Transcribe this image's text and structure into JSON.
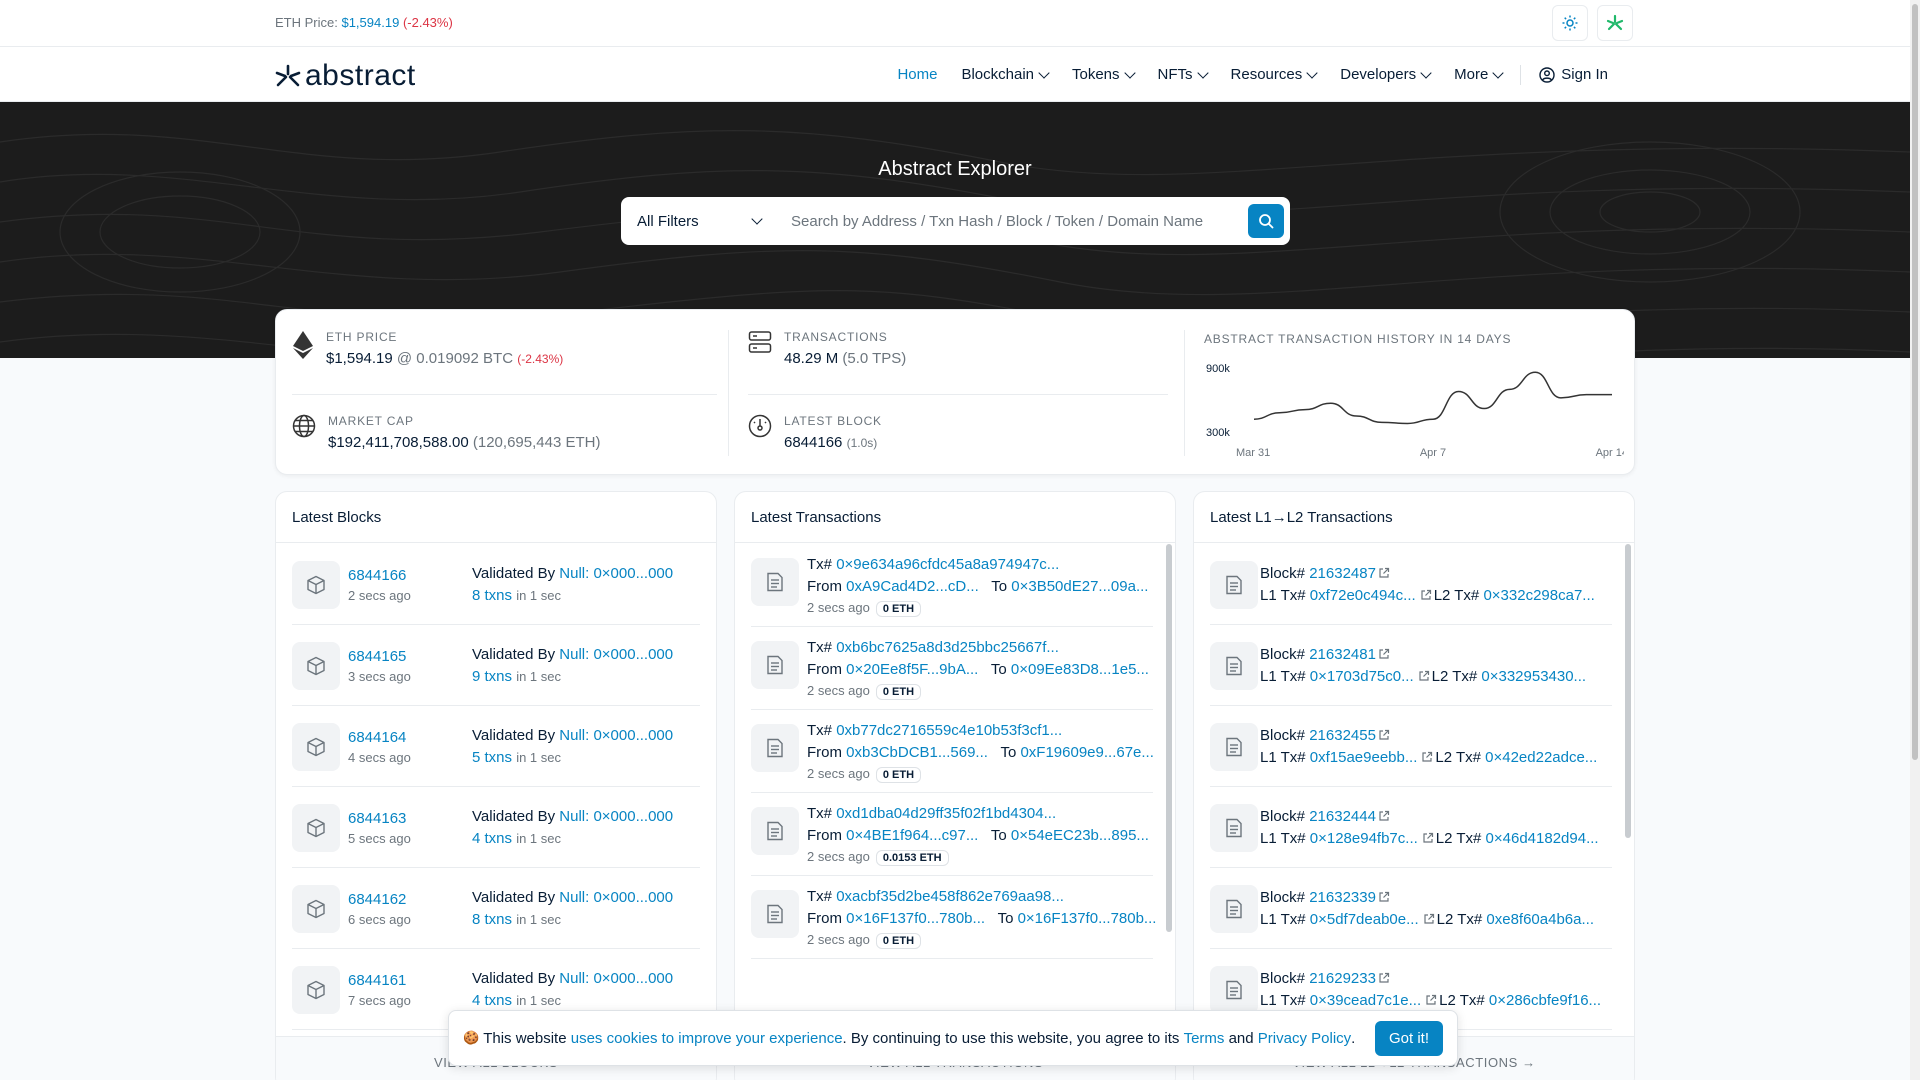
{
  "topbar": {
    "eth_price_label": "ETH Price:",
    "eth_price_value": "$1,594.19",
    "eth_price_change": "(-2.43%)"
  },
  "nav": {
    "logo_text": "abstract",
    "items": [
      "Home",
      "Blockchain",
      "Tokens",
      "NFTs",
      "Resources",
      "Developers",
      "More"
    ],
    "sign_in": "Sign In"
  },
  "hero": {
    "title": "Abstract Explorer",
    "filter": "All Filters",
    "search_placeholder": "Search by Address / Txn Hash / Block / Token / Domain Name"
  },
  "stats": {
    "eth_price": {
      "label": "ETH PRICE",
      "value": "$1,594.19",
      "btc": "@ 0.019092 BTC",
      "change": "(-2.43%)"
    },
    "market_cap": {
      "label": "MARKET CAP",
      "value": "$192,411,708,588.00",
      "eth": "(120,695,443 ETH)"
    },
    "transactions": {
      "label": "TRANSACTIONS",
      "value": "48.29 M",
      "tps": "(5.0 TPS)"
    },
    "latest_block": {
      "label": "LATEST BLOCK",
      "value": "6844166",
      "time": "(1.0s)"
    }
  },
  "chart_data": {
    "type": "line",
    "title": "ABSTRACT TRANSACTION HISTORY IN 14 DAYS",
    "x": [
      "Mar 31",
      "Apr 1",
      "Apr 2",
      "Apr 3",
      "Apr 4",
      "Apr 5",
      "Apr 6",
      "Apr 7",
      "Apr 8",
      "Apr 9",
      "Apr 10",
      "Apr 11",
      "Apr 12",
      "Apr 13",
      "Apr 14"
    ],
    "values": [
      420000,
      480000,
      510000,
      570000,
      450000,
      390000,
      380000,
      420000,
      680000,
      520000,
      700000,
      860000,
      620000,
      650000,
      650000
    ],
    "x_tick_labels": [
      "Mar 31",
      "Apr 7",
      "Apr 14"
    ],
    "y_tick_labels": [
      "900k",
      "300k"
    ],
    "ylim": [
      300000,
      900000
    ]
  },
  "latest_blocks": {
    "title": "Latest Blocks",
    "validated_by": "Validated By",
    "validator": "Null: 0×000...000",
    "in_label": "in 1 sec",
    "rows": [
      {
        "block": "6844166",
        "age": "2 secs ago",
        "txns": "8 txns"
      },
      {
        "block": "6844165",
        "age": "3 secs ago",
        "txns": "9 txns"
      },
      {
        "block": "6844164",
        "age": "4 secs ago",
        "txns": "5 txns"
      },
      {
        "block": "6844163",
        "age": "5 secs ago",
        "txns": "4 txns"
      },
      {
        "block": "6844162",
        "age": "6 secs ago",
        "txns": "8 txns"
      },
      {
        "block": "6844161",
        "age": "7 secs ago",
        "txns": "4 txns"
      }
    ],
    "footer": "VIEW ALL BLOCKS"
  },
  "latest_transactions": {
    "title": "Latest Transactions",
    "tx_label": "Tx#",
    "from_label": "From",
    "to_label": "To",
    "rows": [
      {
        "hash": "0×9e634a96cfdc45a8a974947c...",
        "from": "0xA9Cad4D2...cD...",
        "to": "0×3B50dE27...09a...",
        "age": "2 secs ago",
        "value": "0 ETH"
      },
      {
        "hash": "0xb6bc7625a8d3d25bbc25667f...",
        "from": "0×20Ee8f5F...9bA...",
        "to": "0×09Ee83D8...1e5...",
        "age": "2 secs ago",
        "value": "0 ETH"
      },
      {
        "hash": "0xb77dc2716559c4e10b53f3cf1...",
        "from": "0xb3CbDCB1...569...",
        "to": "0xF19609e9...67e...",
        "age": "2 secs ago",
        "value": "0 ETH"
      },
      {
        "hash": "0xd1dba04d29ff35f02f1bd4304...",
        "from": "0×4BE1f964...c97...",
        "to": "0×54eEC23b...895...",
        "age": "2 secs ago",
        "value": "0.0153 ETH"
      },
      {
        "hash": "0xacbf35d2be458f862e769aa98...",
        "from": "0×16F137f0...780b...",
        "to": "0×16F137f0...780b...",
        "age": "2 secs ago",
        "value": "0 ETH"
      }
    ],
    "footer": "VIEW ALL TRANSACTIONS"
  },
  "latest_l1l2": {
    "title": "Latest L1→L2 Transactions",
    "block_label": "Block#",
    "l1_label": "L1 Tx#",
    "l2_label": "L2 Tx#",
    "rows": [
      {
        "block": "21632487",
        "l1": "0xf72e0c494c...",
        "l2": "0×332c298ca7..."
      },
      {
        "block": "21632481",
        "l1": "0×1703d75c0...",
        "l2": "0×332953430..."
      },
      {
        "block": "21632455",
        "l1": "0xf15ae9eebb...",
        "l2": "0×42ed22adce..."
      },
      {
        "block": "21632444",
        "l1": "0×128e94fb7c...",
        "l2": "0×46d4182d94..."
      },
      {
        "block": "21632339",
        "l1": "0×5df7deab0e...",
        "l2": "0xe8f60a4b6a..."
      },
      {
        "block": "21629233",
        "l1": "0×39cead7c1e...",
        "l2": "0×286cbfe9f16..."
      }
    ],
    "footer": "VIEW ALL L1→L2 TRANSACTIONS"
  },
  "cookie": {
    "text1": "This website",
    "link1": "uses cookies to improve your experience",
    "text2": ". By continuing to use this website, you agree to its",
    "terms": "Terms",
    "and": "and",
    "privacy": "Privacy Policy",
    "dot": ".",
    "button": "Got it!"
  },
  "colors": {
    "accent": "#0784c3",
    "negative": "#dc3545",
    "hero_bg": "#1c1c1c",
    "green_icon": "#1fb86a"
  }
}
